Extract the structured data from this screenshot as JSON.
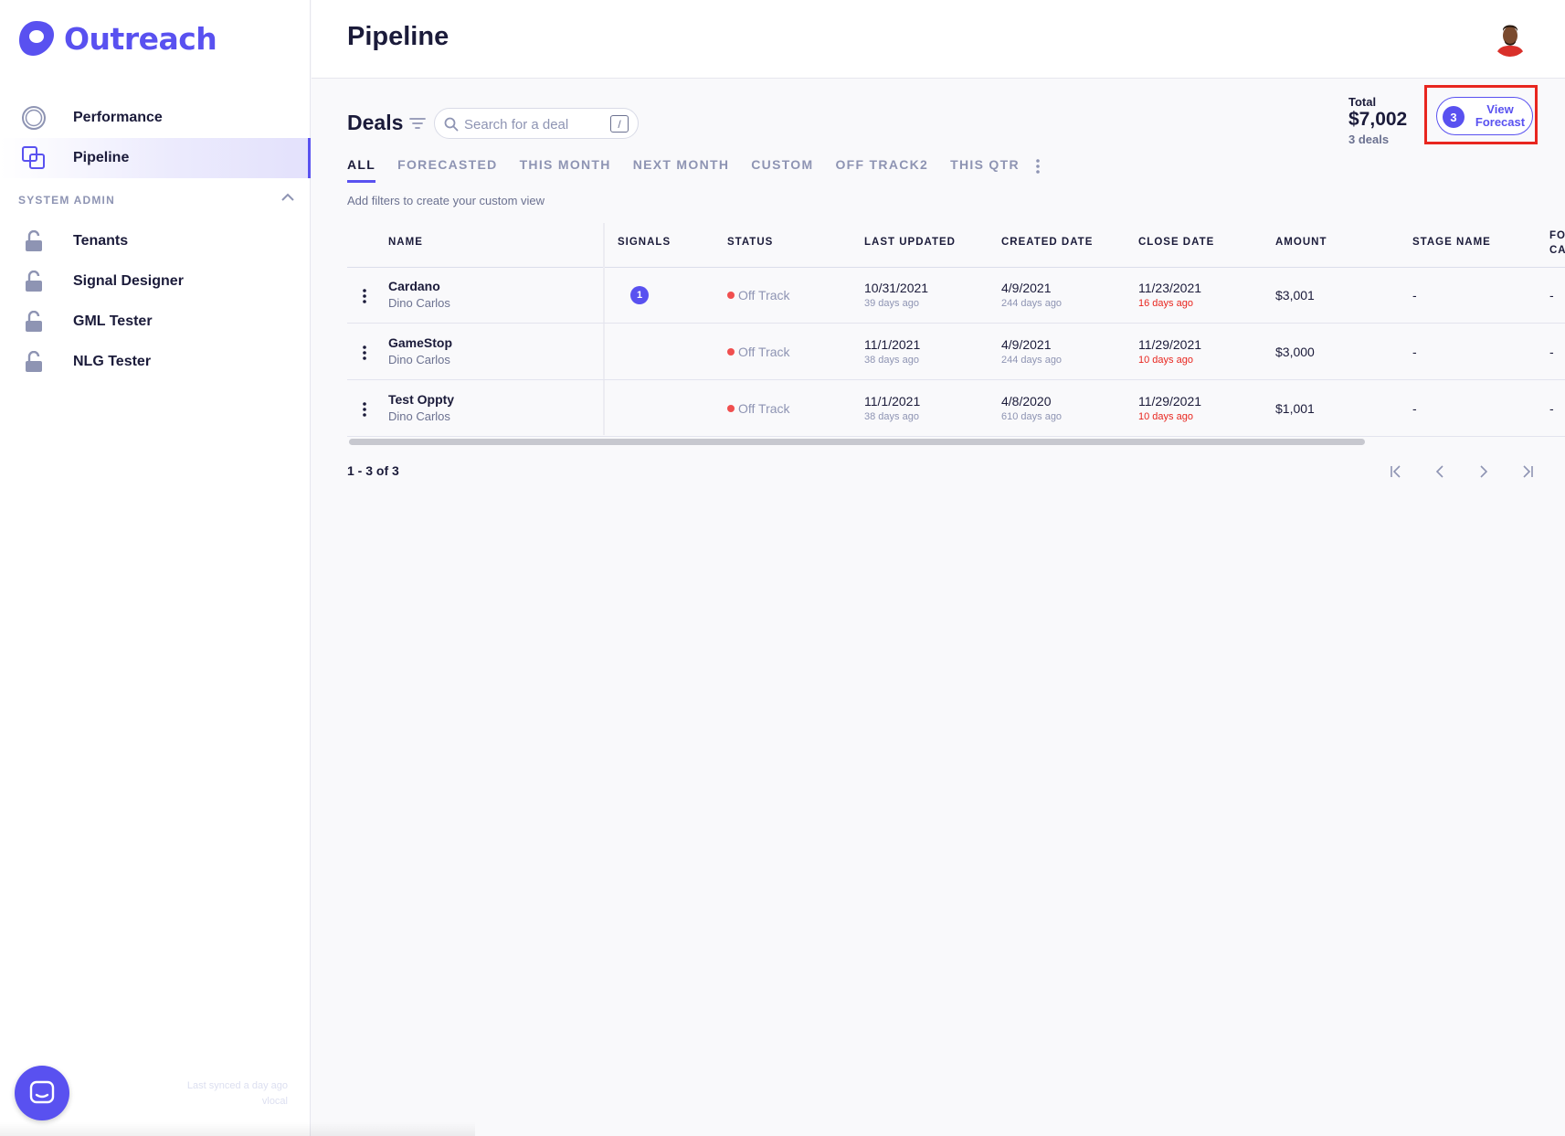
{
  "app": {
    "logo_text": "Outreach",
    "brand_color": "#5951f0"
  },
  "sidebar": {
    "items": [
      {
        "label": "Performance",
        "icon": "circle-ring-icon"
      },
      {
        "label": "Pipeline",
        "icon": "stacked-squares-icon",
        "active": true
      }
    ],
    "section_label": "SYSTEM ADMIN",
    "admin_items": [
      {
        "label": "Tenants",
        "icon": "unlock-icon"
      },
      {
        "label": "Signal Designer",
        "icon": "unlock-icon"
      },
      {
        "label": "GML Tester",
        "icon": "unlock-icon"
      },
      {
        "label": "NLG Tester",
        "icon": "unlock-icon"
      }
    ],
    "sync_text_1": "Last synced a day ago",
    "sync_text_2": "vlocal"
  },
  "header": {
    "title": "Pipeline"
  },
  "deals": {
    "title": "Deals",
    "search_placeholder": "Search for a deal",
    "search_shortcut": "/",
    "total_label": "Total",
    "total_value": "$7,002",
    "total_count": "3 deals",
    "forecast_badge": "3",
    "forecast_label": "View Forecast",
    "tabs": [
      "ALL",
      "FORECASTED",
      "THIS MONTH",
      "NEXT MONTH",
      "CUSTOM",
      "OFF TRACK2",
      "THIS QTR"
    ],
    "hint": "Add filters to create your custom view"
  },
  "table": {
    "columns": [
      "NAME",
      "SIGNALS",
      "STATUS",
      "LAST UPDATED",
      "CREATED DATE",
      "CLOSE DATE",
      "AMOUNT",
      "STAGE NAME",
      "FO",
      "CA"
    ],
    "rows": [
      {
        "name": "Cardano",
        "owner": "Dino Carlos",
        "signals": "1",
        "status": "Off Track",
        "last_updated": "10/31/2021",
        "last_updated_ago": "39 days ago",
        "created": "4/9/2021",
        "created_ago": "244 days ago",
        "close": "11/23/2021",
        "close_ago": "16 days ago",
        "amount": "$3,001",
        "stage": "-",
        "forecast": "-"
      },
      {
        "name": "GameStop",
        "owner": "Dino Carlos",
        "signals": "",
        "status": "Off Track",
        "last_updated": "11/1/2021",
        "last_updated_ago": "38 days ago",
        "created": "4/9/2021",
        "created_ago": "244 days ago",
        "close": "11/29/2021",
        "close_ago": "10 days ago",
        "amount": "$3,000",
        "stage": "-",
        "forecast": "-"
      },
      {
        "name": "Test Oppty",
        "owner": "Dino Carlos",
        "signals": "",
        "status": "Off Track",
        "last_updated": "11/1/2021",
        "last_updated_ago": "38 days ago",
        "created": "4/8/2020",
        "created_ago": "610 days ago",
        "close": "11/29/2021",
        "close_ago": "10 days ago",
        "amount": "$1,001",
        "stage": "-",
        "forecast": "-"
      }
    ],
    "pagination": "1 - 3 of 3"
  }
}
